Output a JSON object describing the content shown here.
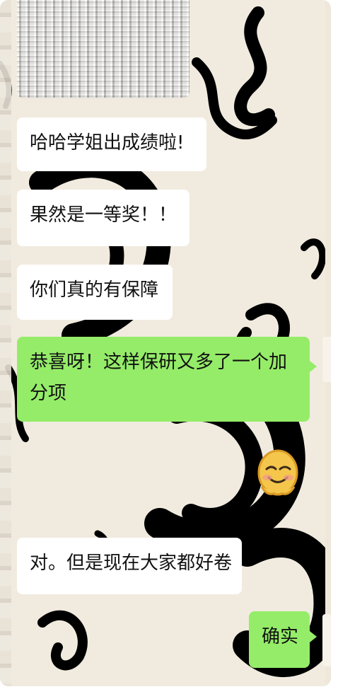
{
  "chat": {
    "messages": [
      {
        "text": "哈哈学姐出成绩啦!",
        "side": "incoming"
      },
      {
        "text": "果然是一等奖！！",
        "side": "incoming"
      },
      {
        "text": "你们真的有保障",
        "side": "incoming"
      },
      {
        "text": "恭喜呀！这样保研又多了一个加分项",
        "side": "outgoing"
      },
      {
        "text": "对。但是现在大家都好卷",
        "side": "incoming"
      },
      {
        "text": "确实",
        "side": "outgoing"
      }
    ]
  },
  "colors": {
    "incoming_bubble": "#ffffff",
    "outgoing_bubble": "#95ec69",
    "wallpaper": "#f1ebdf"
  },
  "icons": {
    "emoji": "happy-blush-emoji-icon"
  }
}
